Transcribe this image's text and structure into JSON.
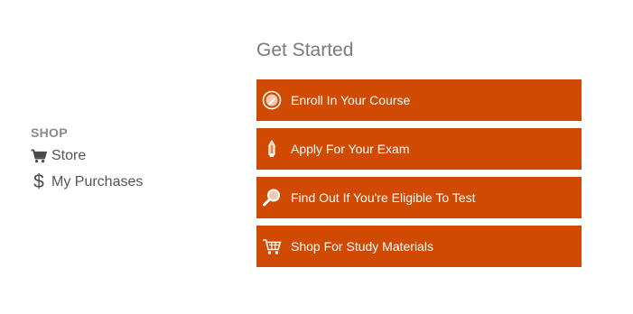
{
  "sidebar": {
    "heading": "SHOP",
    "items": [
      {
        "label": "Store",
        "icon": "cart-icon"
      },
      {
        "label": "My Purchases",
        "icon": "dollar-icon"
      }
    ]
  },
  "main": {
    "title": "Get Started",
    "actions": [
      {
        "label": "Enroll In Your Course",
        "icon": "pencil-badge-icon"
      },
      {
        "label": "Apply For Your Exam",
        "icon": "pencil-icon"
      },
      {
        "label": "Find Out If You're Eligible To Test",
        "icon": "magnifier-icon"
      },
      {
        "label": "Shop For Study Materials",
        "icon": "cart-icon"
      }
    ],
    "accent_color": "#d04a02"
  }
}
